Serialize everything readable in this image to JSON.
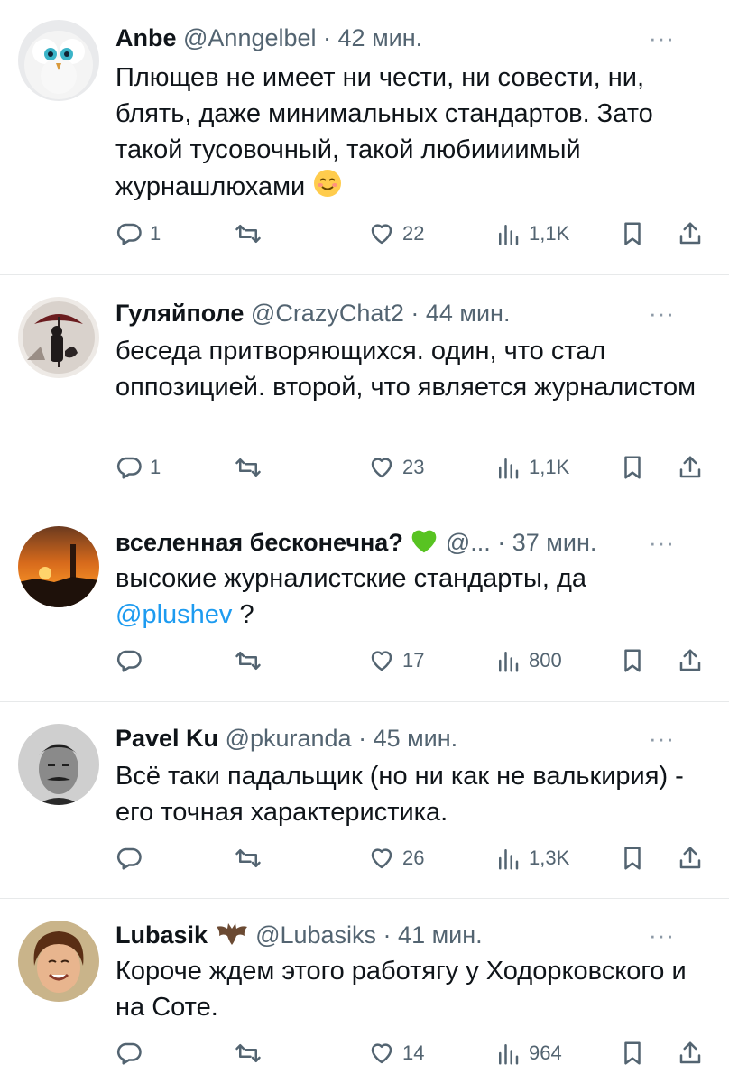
{
  "tweets": [
    {
      "name": "Anbe",
      "handle": "@Anngelbel",
      "time": "42 мин.",
      "text": "Плющев не имеет ни чести, ни совести, ни, блять, даже минимальных стандартов. Зато такой тусовочный, такой любиииимый журнашлюхами",
      "emoji": "relieved-face",
      "replies": "1",
      "retweets": "",
      "likes": "22",
      "views": "1,1K"
    },
    {
      "name": "Гуляйполе",
      "handle": "@CrazyChat2",
      "time": "44 мин.",
      "text": "беседа притворяющихся. один, что стал оппозицией. второй, что является журналистом",
      "replies": "1",
      "retweets": "",
      "likes": "23",
      "views": "1,1K"
    },
    {
      "name": "вселенная бесконечна?",
      "name_emoji": "green-heart",
      "handle": "@...",
      "time": "37 мин.",
      "text": "высокие журналистские стандарты, да",
      "mention": "@plushev",
      "text_after": " ?",
      "replies": "",
      "retweets": "",
      "likes": "17",
      "views": "800"
    },
    {
      "name": "Pavel Ku",
      "handle": "@pkuranda",
      "time": "45 мин.",
      "text": "Всё таки падальщик (но ни как не валькирия) - его точная характеристика.",
      "replies": "",
      "retweets": "",
      "likes": "26",
      "views": "1,3K"
    },
    {
      "name": "Lubasik",
      "name_emoji": "bat",
      "handle": "@Lubasiks",
      "time": "41 мин.",
      "text": "Короче ждем этого работягу у Ходорковского и на Соте.",
      "replies": "",
      "retweets": "",
      "likes": "14",
      "views": "964"
    }
  ],
  "ui": {
    "separator": " · ",
    "more_glyph": "···"
  },
  "icons": {
    "reply": "reply-icon",
    "retweet": "retweet-icon",
    "like": "heart-icon",
    "views": "views-chart-icon",
    "bookmark": "bookmark-icon",
    "share": "share-icon"
  },
  "colors": {
    "text": "#0f1419",
    "secondary": "#536471",
    "link": "#1d9bf0",
    "divider": "#e7e9ea"
  }
}
